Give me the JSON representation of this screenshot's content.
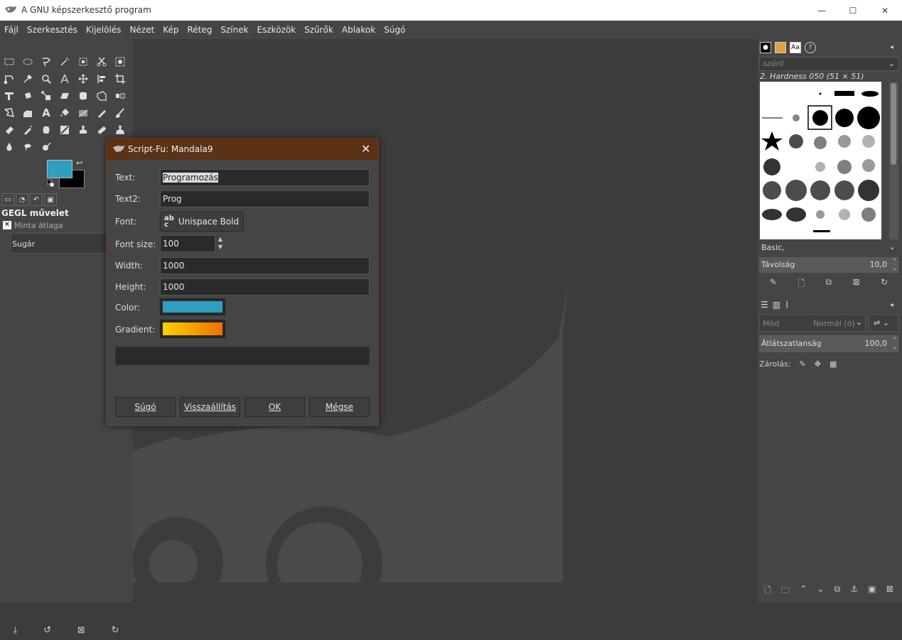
{
  "window": {
    "title": "A GNU képszerkesztő program",
    "min": "—",
    "max": "☐",
    "close": "✕"
  },
  "menu": [
    "Fájl",
    "Szerkesztés",
    "Kijelölés",
    "Nézet",
    "Kép",
    "Réteg",
    "Színek",
    "Eszközök",
    "Szűrők",
    "Ablakok",
    "Súgó"
  ],
  "toolbox": {
    "fg_color": "#2f9fbf",
    "bg_color": "#000000",
    "panel_title": "GEGL művelet",
    "option_label": "Minta átlaga",
    "radius_label": "Sugár"
  },
  "brushes": {
    "filter_placeholder": "szűrő",
    "selected": "2. Hardness 050 (51 × 51)",
    "tag": "Basic,",
    "spacing_label": "Távolság",
    "spacing_value": "10,0"
  },
  "layers": {
    "mode_label": "Mód",
    "mode_value": "Normál (ó)",
    "opacity_label": "Átlátszatlanság",
    "opacity_value": "100,0",
    "lock_label": "Zárolás:"
  },
  "dialog": {
    "title": "Script-Fu: Mandala9",
    "fields": {
      "text_label": "Text:",
      "text_value": "Programozás",
      "text2_label": "Text2:",
      "text2_value": "Prog",
      "font_label": "Font:",
      "font_value": "Unispace Bold",
      "fontsize_label": "Font size:",
      "fontsize_value": "100",
      "width_label": "Width:",
      "width_value": "1000",
      "height_label": "Height:",
      "height_value": "1000",
      "color_label": "Color:",
      "color_value": "#2f9fbf",
      "gradient_label": "Gradient:"
    },
    "buttons": {
      "help": "Súgó",
      "reset": "Visszaállítás",
      "ok": "OK",
      "cancel": "Mégse"
    }
  }
}
